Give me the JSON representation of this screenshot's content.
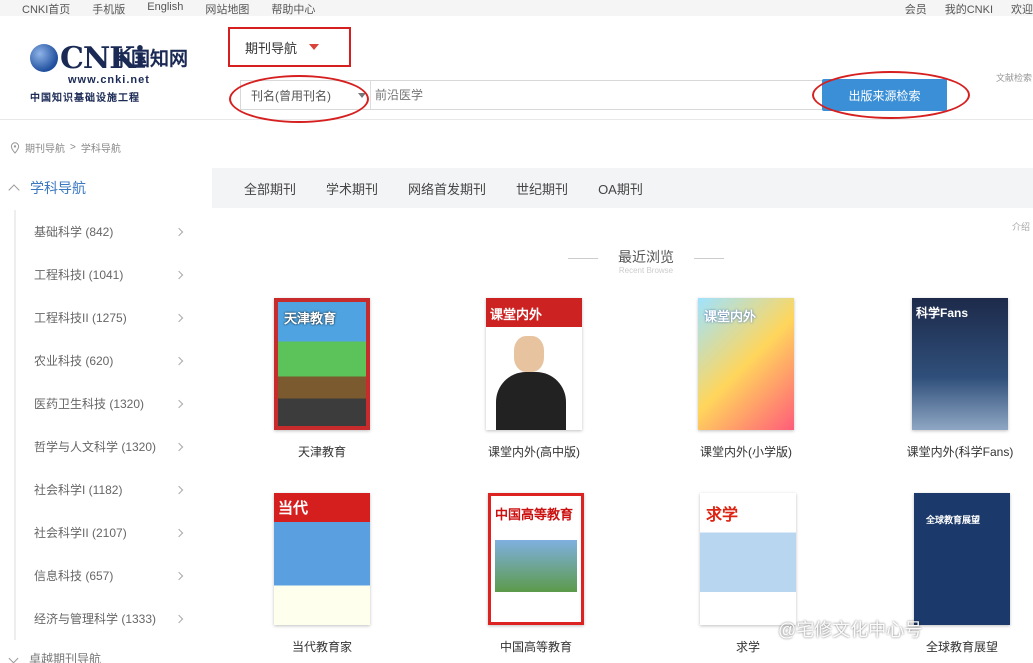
{
  "topbar": {
    "left": [
      "CNKI首页",
      "手机版",
      "English",
      "网站地图",
      "帮助中心"
    ],
    "right": [
      "会员",
      "我的CNKI",
      "欢迎"
    ]
  },
  "logo": {
    "mark": "CNKi",
    "cn": "中国知网",
    "url": "www.cnki.net",
    "sub": "中国知识基础设施工程"
  },
  "header": {
    "nav_dropdown": "期刊导航",
    "search_field": "刊名(曾用刊名)",
    "search_placeholder": "前沿医学",
    "source_button": "出版来源检索",
    "side_link": "文献检索"
  },
  "breadcrumb": [
    "期刊导航",
    ">",
    "学科导航"
  ],
  "sidebar": {
    "title": "学科导航",
    "items": [
      {
        "label": "基础科学 (842)"
      },
      {
        "label": "工程科技I (1041)"
      },
      {
        "label": "工程科技II (1275)"
      },
      {
        "label": "农业科技 (620)"
      },
      {
        "label": "医药卫生科技 (1320)"
      },
      {
        "label": "哲学与人文科学 (1320)"
      },
      {
        "label": "社会科学I (1182)"
      },
      {
        "label": "社会科学II (2107)"
      },
      {
        "label": "信息科技 (657)"
      },
      {
        "label": "经济与管理科学 (1333)"
      }
    ],
    "footer": "卓越期刊导航"
  },
  "tabs": [
    "全部期刊",
    "学术期刊",
    "网络首发期刊",
    "世纪期刊",
    "OA期刊"
  ],
  "right_note": "介绍",
  "recent": {
    "title": "最近浏览",
    "subtitle": "Recent Browse"
  },
  "journals": [
    {
      "name": "天津教育",
      "cover_text": "天津教育"
    },
    {
      "name": "课堂内外(高中版)",
      "cover_text": "课堂内外"
    },
    {
      "name": "课堂内外(小学版)",
      "cover_text": "课堂内外"
    },
    {
      "name": "课堂内外(科学Fans)",
      "cover_text": "科学Fans"
    },
    {
      "name": "当代教育家",
      "cover_text": "当代"
    },
    {
      "name": "中国高等教育",
      "cover_text": "中国高等教育"
    },
    {
      "name": "求学",
      "cover_text": "求学"
    },
    {
      "name": "全球教育展望",
      "cover_text": "全球教育展望"
    }
  ],
  "watermark": "@宅修文化中心号",
  "colors": {
    "accent_blue": "#3a8fd6",
    "annotation_red": "#d62020",
    "sidebar_title": "#3a78c0"
  }
}
